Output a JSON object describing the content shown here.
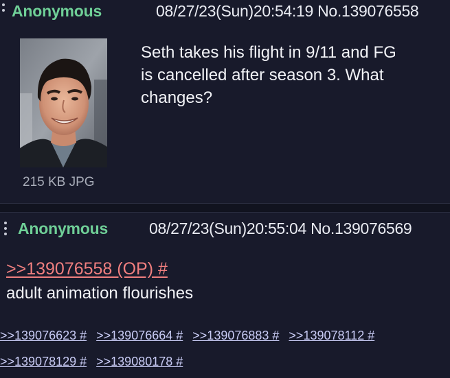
{
  "post1": {
    "name": "Anonymous",
    "datetime": "08/27/23(Sun)20:54:19",
    "number": "No.139076558",
    "file_info": "215 KB JPG",
    "body_lines": [
      "Seth takes his flight in 9/11 and FG",
      "is cancelled after season 3. What",
      "changes?"
    ]
  },
  "post2": {
    "name": "Anonymous",
    "datetime": "08/27/23(Sun)20:55:04",
    "number": "No.139076569",
    "quote_link": ">>139076558 (OP) #",
    "body": "adult animation flourishes",
    "replies_row1": [
      ">>139076623 #",
      ">>139076664 #",
      ">>139076883 #",
      ">>139078112 #"
    ],
    "replies_row2": [
      ">>139078129 #",
      ">>139080178 #"
    ]
  },
  "colors": {
    "background": "#11131f",
    "post_background": "#181a2b",
    "name": "#6fcf97",
    "quote_link": "#f07f7f",
    "reply_link": "#c8cbf4"
  }
}
